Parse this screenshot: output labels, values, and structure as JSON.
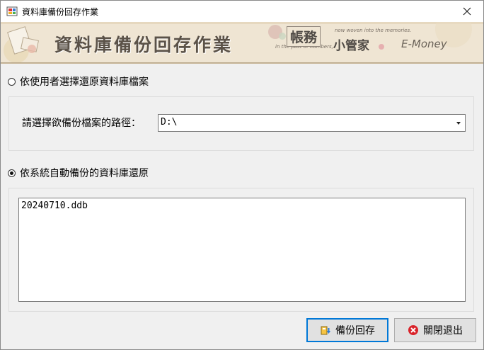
{
  "window": {
    "title": "資料庫備份回存作業"
  },
  "banner": {
    "title": "資料庫備份回存作業",
    "tagline_left": "in the past of numbers,",
    "brand": "帳務",
    "tagline_right": "now woven into the memories.",
    "brand_sub": "小管家",
    "emoney": "E-Money"
  },
  "option_file": {
    "label": "依使用者選擇還原資料庫檔案",
    "checked": false,
    "path_label": "請選擇欲備份檔案的路徑：",
    "path_value": "D:\\"
  },
  "option_auto": {
    "label": "依系統自動備份的資料庫還原",
    "checked": true,
    "files": [
      "20240710.ddb"
    ]
  },
  "buttons": {
    "restore": "備份回存",
    "exit": "關閉退出"
  },
  "icons": {
    "app": "app-icon",
    "close": "close-icon",
    "restore": "database-restore-icon",
    "exit": "exit-icon"
  }
}
